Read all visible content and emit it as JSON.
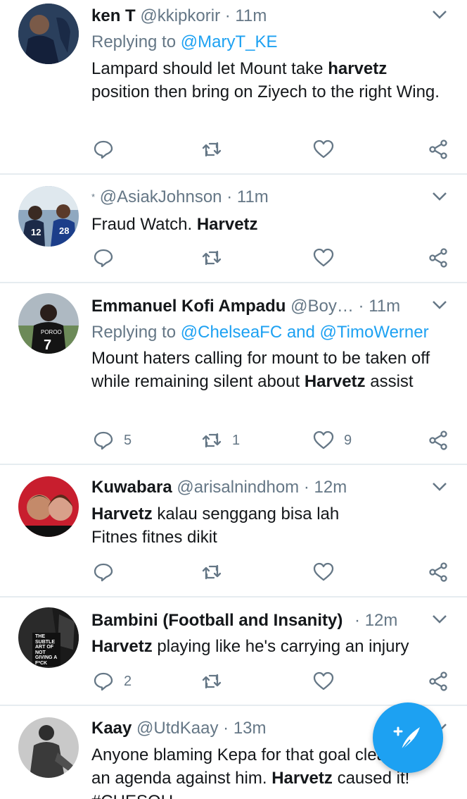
{
  "tweets": [
    {
      "name": "ken T",
      "handle": "@kkipkorir",
      "time": "11m",
      "reply_prefix": "Replying to",
      "reply_mentions": "@MaryT_KE",
      "body_pre": "Lampard should let Mount take ",
      "body_bold": "harvetz",
      "body_post": " position then bring on Ziyech to the right Wing.",
      "replies": "",
      "retweets": "",
      "likes": ""
    },
    {
      "name": "*",
      "handle": "@AsiakJohnson",
      "time": "11m",
      "body_pre": "Fraud Watch. ",
      "body_bold": "Harvetz",
      "body_post": "",
      "replies": "",
      "retweets": "",
      "likes": ""
    },
    {
      "name": "Emmanuel Kofi Ampadu",
      "handle": "@Boy…",
      "time": "11m",
      "reply_prefix": "Replying to",
      "reply_mentions": "@ChelseaFC and @TimoWerner",
      "body_pre": "Mount haters calling for mount to be taken off while remaining silent about ",
      "body_bold": "Harvetz",
      "body_post": " assist",
      "replies": "5",
      "retweets": "1",
      "likes": "9"
    },
    {
      "name": "Kuwabara",
      "handle": "@arisalnindhom",
      "time": "12m",
      "body_pre": "",
      "body_bold": "Harvetz",
      "body_post": " kalau senggang bisa lah Fitnes fitnes dikit",
      "replies": "",
      "retweets": "",
      "likes": ""
    },
    {
      "name": "Bambini (Football and Insanity)",
      "handle": "",
      "time": "12m",
      "body_pre": "",
      "body_bold": "Harvetz",
      "body_post": " playing like he's carrying an injury",
      "replies": "2",
      "retweets": "",
      "likes": ""
    },
    {
      "name": "Kaay",
      "handle": "@UtdKaay",
      "time": "13m",
      "body_pre": "Anyone blaming Kepa for that goal clearly has an agenda against him. ",
      "body_bold": "Harvetz",
      "body_post": " caused it! #CHESOU",
      "replies": "",
      "retweets": "",
      "likes": ""
    }
  ],
  "avatar5_text": "THE SUBTLE ART OF NOT GIVING A F*CK",
  "avatar2_jersey_numbers": [
    "12",
    "28"
  ],
  "avatar3_jersey": {
    "name": "POROO",
    "number": "7"
  },
  "colors": {
    "accent": "#1da1f2",
    "muted": "#657786",
    "text": "#14171a",
    "divider": "#e6ecf0"
  },
  "icons": [
    "reply-icon",
    "retweet-icon",
    "like-icon",
    "share-icon",
    "caret-down-icon",
    "compose-tweet-icon"
  ]
}
